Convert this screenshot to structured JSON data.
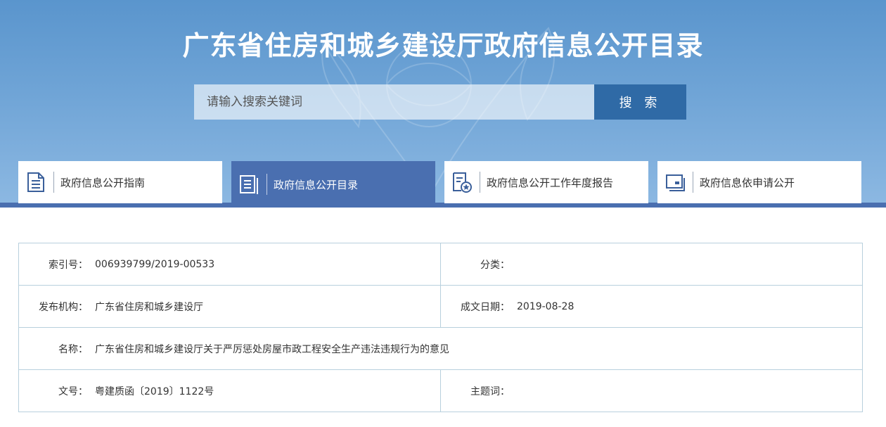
{
  "header": {
    "title": "广东省住房和城乡建设厅政府信息公开目录"
  },
  "search": {
    "placeholder": "请输入搜索关键词",
    "button_label": "搜 索"
  },
  "nav": {
    "tabs": [
      {
        "label": "政府信息公开指南",
        "icon": "document-list-icon",
        "active": false
      },
      {
        "label": "政府信息公开目录",
        "icon": "catalog-icon",
        "active": true
      },
      {
        "label": "政府信息公开工作年度报告",
        "icon": "report-star-icon",
        "active": false
      },
      {
        "label": "政府信息依申请公开",
        "icon": "application-icon",
        "active": false
      }
    ]
  },
  "info": {
    "index_label": "索引号：",
    "index_value": "006939799/2019-00533",
    "category_label": "分类：",
    "category_value": "",
    "publisher_label": "发布机构：",
    "publisher_value": "广东省住房和城乡建设厅",
    "date_label": "成文日期：",
    "date_value": "2019-08-28",
    "name_label": "名称：",
    "name_value": "广东省住房和城乡建设厅关于严厉惩处房屋市政工程安全生产违法违规行为的意见",
    "docno_label": "文号：",
    "docno_value": "粤建质函〔2019〕1122号",
    "subject_label": "主题词：",
    "subject_value": ""
  },
  "colors": {
    "banner": "#6fa4d6",
    "accent": "#4a6fb0",
    "button": "#2f6aa6",
    "table_border": "#b8d0dd"
  }
}
